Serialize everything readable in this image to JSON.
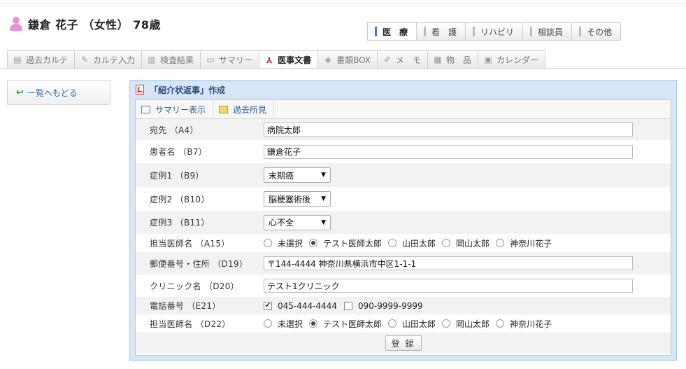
{
  "header": {
    "patient": "鎌倉 花子 （女性） 78歳"
  },
  "categories": [
    {
      "label": "医　療",
      "active": true
    },
    {
      "label": "看　護",
      "active": false
    },
    {
      "label": "リハビリ",
      "active": false
    },
    {
      "label": "相談員",
      "active": false
    },
    {
      "label": "その他",
      "active": false
    }
  ],
  "tabs": [
    {
      "label": "過去カルテ",
      "icon": "document-list-icon",
      "glyph": "▤"
    },
    {
      "label": "カルテ入力",
      "icon": "edit-icon",
      "glyph": "✎"
    },
    {
      "label": "検査結果",
      "icon": "bar-chart-icon",
      "glyph": "▥"
    },
    {
      "label": "サマリー",
      "icon": "summary-icon",
      "glyph": "▭"
    },
    {
      "label": "医事文書",
      "icon": "pdf-icon",
      "glyph": "⅄"
    },
    {
      "label": "書類BOX",
      "icon": "box-icon",
      "glyph": "◈"
    },
    {
      "label": "メ　モ",
      "icon": "pen-icon",
      "glyph": "✐"
    },
    {
      "label": "物　品",
      "icon": "basket-icon",
      "glyph": "▦"
    },
    {
      "label": "カレンダー",
      "icon": "calendar-icon",
      "glyph": "▣"
    }
  ],
  "back_button": {
    "label": "一覧へもどる"
  },
  "panel": {
    "title": "「紹介状返事」作成",
    "toolbar": {
      "summary": "サマリー表示",
      "past": "過去所見"
    }
  },
  "form": {
    "recipient": {
      "label": "宛先 （A4）",
      "value": "病院太郎"
    },
    "patient_name": {
      "label": "患者名 （B7）",
      "value": "鎌倉花子"
    },
    "case1": {
      "label": "症例1 （B9）",
      "value": "末期癌"
    },
    "case2": {
      "label": "症例2 （B10）",
      "value": "脳梗塞術後"
    },
    "case3": {
      "label": "症例3 （B11）",
      "value": "心不全"
    },
    "doctor1": {
      "label": "担当医師名 （A15）",
      "options": [
        "未選択",
        "テスト医師太郎",
        "山田太郎",
        "岡山太郎",
        "神奈川花子"
      ],
      "selected": "テスト医師太郎"
    },
    "address": {
      "label": "郵便番号・住所 （D19）",
      "value": "〒144-4444 神奈川県横浜市中区1-1-1"
    },
    "clinic": {
      "label": "クリニック名 （D20）",
      "value": "テスト1クリニック"
    },
    "phone": {
      "label": "電話番号 （E21）",
      "options": [
        {
          "value": "045-444-4444",
          "checked": true
        },
        {
          "value": "090-9999-9999",
          "checked": false
        }
      ]
    },
    "doctor2": {
      "label": "担当医師名 （D22）",
      "options": [
        "未選択",
        "テスト医師太郎",
        "山田太郎",
        "岡山太郎",
        "神奈川花子"
      ],
      "selected": "テスト医師太郎"
    },
    "submit_label": "登 録"
  }
}
